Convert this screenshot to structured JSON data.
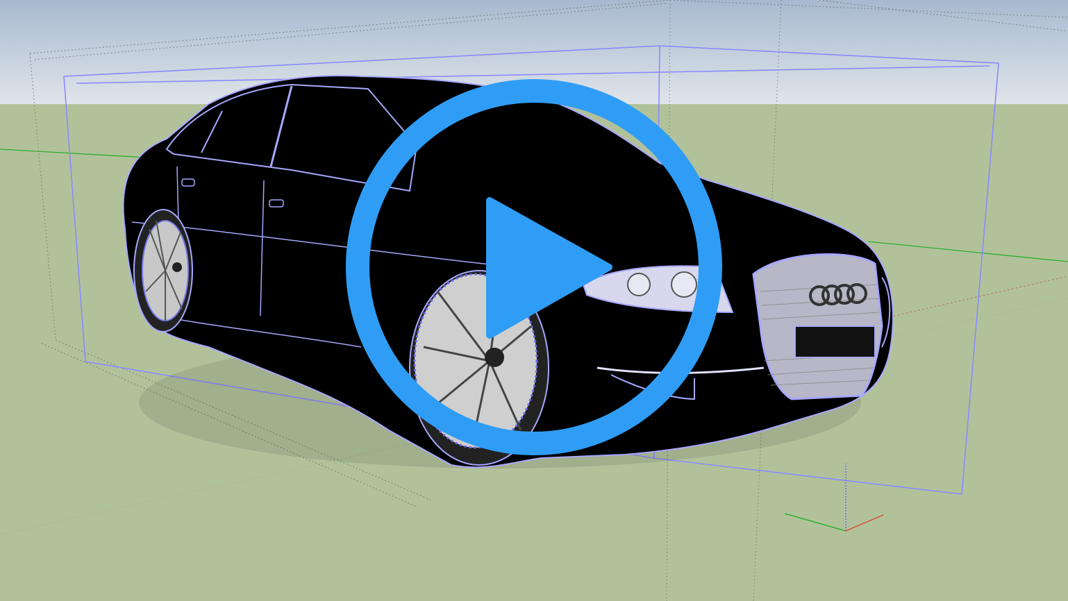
{
  "viewport": {
    "type": "3D modeling viewport",
    "colors": {
      "sky_top": "#a8b9cf",
      "sky_bottom": "#dfe5ea",
      "ground": "#b1c29b",
      "car_body": "#000000",
      "car_edges": "#a8a8ff",
      "selection_box": "#8a8aff",
      "play_button": "#2f9df5",
      "axis_red": "#d9523c",
      "axis_green": "#2fae2f",
      "axis_blue": "#6a6aff"
    }
  },
  "model": {
    "name": "sedan-car",
    "selected": true,
    "emblem_icon": "four-rings-logo-icon"
  },
  "overlay": {
    "icon": "play-icon"
  }
}
